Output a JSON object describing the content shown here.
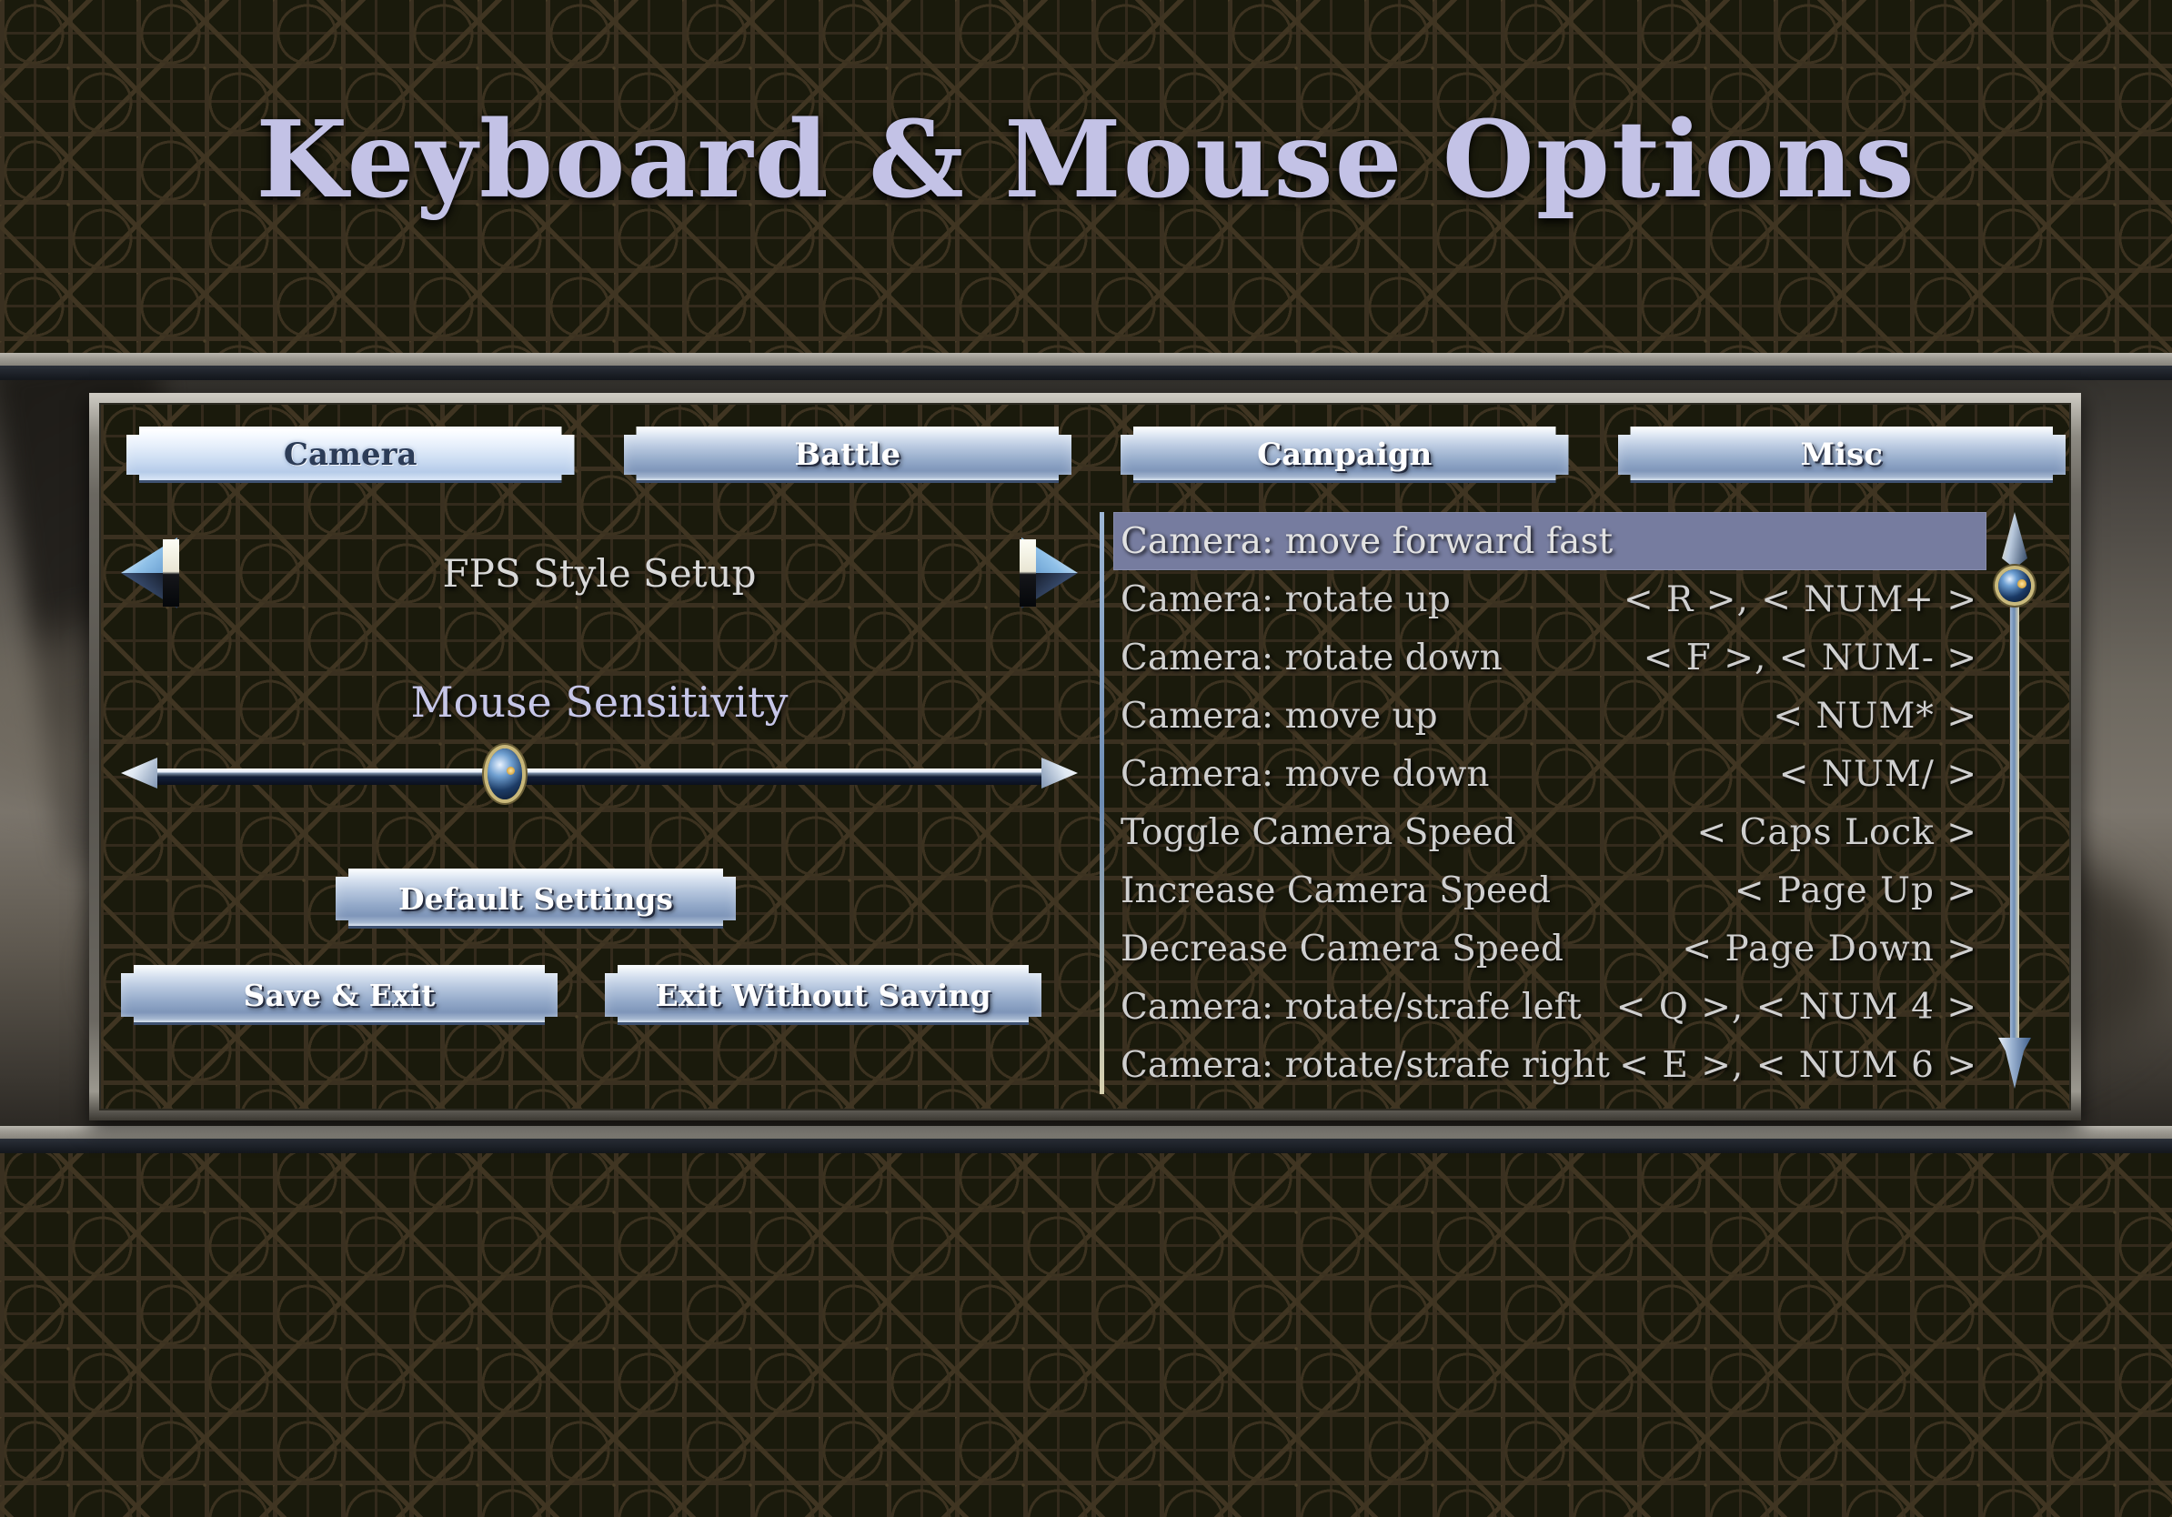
{
  "title": "Keyboard & Mouse Options",
  "tabs": [
    {
      "label": "Camera",
      "active": true
    },
    {
      "label": "Battle",
      "active": false
    },
    {
      "label": "Campaign",
      "active": false
    },
    {
      "label": "Misc",
      "active": false
    }
  ],
  "left_panel": {
    "style_selector": {
      "value": "FPS Style Setup",
      "prev_icon": "arrow-left-icon",
      "next_icon": "arrow-right-icon"
    },
    "sensitivity": {
      "label": "Mouse Sensitivity",
      "value_percent": 39,
      "left_icon": "arrow-left-icon",
      "right_icon": "arrow-right-icon"
    },
    "buttons": {
      "default_settings": "Default Settings",
      "save_exit": "Save & Exit",
      "exit_without_saving": "Exit Without Saving"
    }
  },
  "bindings": [
    {
      "action": "Camera: move forward fast",
      "keys": "",
      "selected": true
    },
    {
      "action": "Camera: rotate up",
      "keys": "< R >,   < NUM+ >",
      "selected": false
    },
    {
      "action": "Camera: rotate down",
      "keys": "< F >,   < NUM- >",
      "selected": false
    },
    {
      "action": "Camera: move up",
      "keys": "< NUM* >",
      "selected": false
    },
    {
      "action": "Camera: move down",
      "keys": "< NUM/ >",
      "selected": false
    },
    {
      "action": "Toggle Camera Speed",
      "keys": "< Caps Lock >",
      "selected": false
    },
    {
      "action": "Increase Camera Speed",
      "keys": "< Page Up >",
      "selected": false
    },
    {
      "action": "Decrease Camera Speed",
      "keys": "< Page Down >",
      "selected": false
    },
    {
      "action": "Camera: rotate/strafe left",
      "keys": "< Q >,   < NUM 4 >",
      "selected": false
    },
    {
      "action": "Camera: rotate/strafe right",
      "keys": "< E >,   < NUM 6 >",
      "selected": false
    }
  ],
  "scrollbar": {
    "thumb_position_percent": 7,
    "down_icon": "arrow-down-icon",
    "spear_icon": "spear-tip-icon"
  },
  "colors": {
    "title_text": "#c3c2e6",
    "selection": "#767c9f",
    "button_face": "#b9c9e0",
    "background_tile": "#1a1a0c",
    "pattern_line": "#403522"
  }
}
